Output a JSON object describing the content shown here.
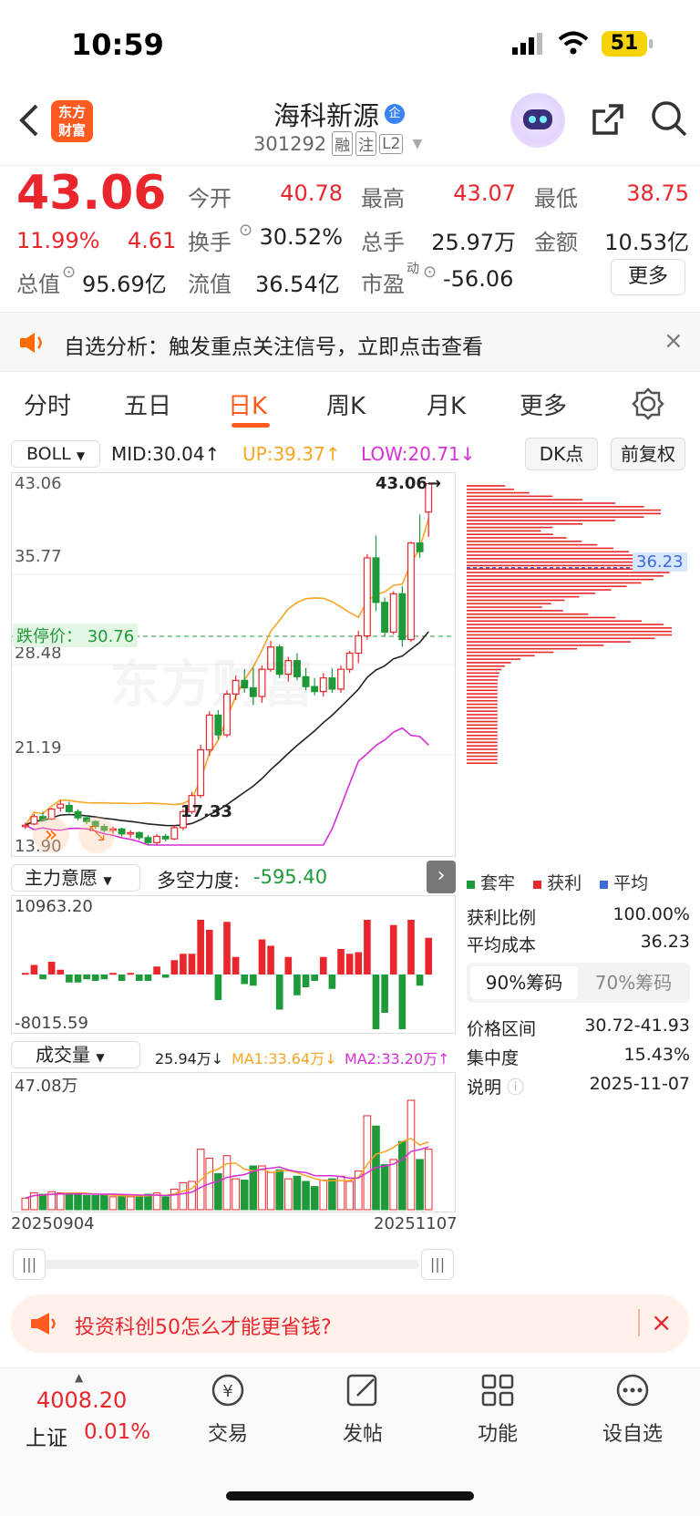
{
  "status": {
    "time": "10:59",
    "battery": "51"
  },
  "header": {
    "logo_line1": "东方",
    "logo_line2": "财富",
    "stock_name": "海科新源",
    "badge": "企",
    "code": "301292",
    "tags": [
      "融",
      "注",
      "L2"
    ]
  },
  "quote": {
    "price": "43.06",
    "pct": "11.99%",
    "change": "4.61",
    "open_label": "今开",
    "open": "40.78",
    "high_label": "最高",
    "high": "43.07",
    "low_label": "最低",
    "low": "38.75",
    "turnover_label": "换手",
    "turnover": "30.52%",
    "volume_label": "总手",
    "volume": "25.97万",
    "amount_label": "金额",
    "amount": "10.53亿",
    "mktcap_label": "总值",
    "mktcap": "95.69亿",
    "float_label": "流值",
    "float_cap": "36.54亿",
    "pe_label": "市盈",
    "pe_sup": "动",
    "pe": "-56.06",
    "more": "更多"
  },
  "notice": {
    "text": "自选分析：触发重点关注信号，立即点击查看"
  },
  "tabs": [
    "分时",
    "五日",
    "日K",
    "周K",
    "月K",
    "更多"
  ],
  "indicator": {
    "name": "BOLL",
    "mid": "MID:30.04↑",
    "up": "UP:39.37↑",
    "low": "LOW:20.71↓",
    "dk": "DK点",
    "fq": "前复权"
  },
  "kchart": {
    "y_labels": [
      "43.06",
      "35.77",
      "28.48",
      "21.19",
      "13.90"
    ],
    "limit_down": "跌停价： 30.76",
    "max_label": "43.06→",
    "min_label": "17.33",
    "watermark": "东方财富",
    "cost_avg": "36.23"
  },
  "flow": {
    "name": "主力意愿",
    "label": "多空力度:",
    "value": "-595.40",
    "max": "10963.20",
    "min": "-8015.59"
  },
  "vol": {
    "name": "成交量",
    "cur": "25.94万↓",
    "ma1": "MA1:33.64万↓",
    "ma2": "MA2:33.20万↑",
    "max": "47.08万",
    "date_start": "20250904",
    "date_end": "20251107"
  },
  "chips": {
    "legend": [
      "套牢",
      "获利",
      "平均"
    ],
    "profit_label": "获利比例",
    "profit": "100.00%",
    "avg_label": "平均成本",
    "avg": "36.23",
    "tab90": "90%筹码",
    "tab70": "70%筹码",
    "range_label": "价格区间",
    "range": "30.72-41.93",
    "conc_label": "集中度",
    "conc": "15.43%",
    "note_label": "说明",
    "date": "2025-11-07"
  },
  "ad": {
    "text": "投资科创50怎么才能更省钱?"
  },
  "bottom": {
    "index_value": "4008.20",
    "index_name": "上证",
    "index_pct": "0.01%",
    "items": [
      "交易",
      "发帖",
      "功能",
      "设自选"
    ]
  },
  "colors": {
    "up": "#e8262c",
    "down": "#1f9a3a",
    "boll_up": "#f5a623",
    "boll_low": "#d62fd6",
    "accent": "#ff6a00"
  },
  "chart_data": {
    "type": "candlestick",
    "candles": [
      [
        15.4,
        15.7,
        15.2,
        15.5
      ],
      [
        15.6,
        16.4,
        15.5,
        16.2
      ],
      [
        16.2,
        16.6,
        15.8,
        15.9
      ],
      [
        16.0,
        16.9,
        15.9,
        16.8
      ],
      [
        16.9,
        17.5,
        16.6,
        17.2
      ],
      [
        17.1,
        17.4,
        16.5,
        16.6
      ],
      [
        16.6,
        16.8,
        15.9,
        16.1
      ],
      [
        16.1,
        16.3,
        15.6,
        15.8
      ],
      [
        15.8,
        15.9,
        15.2,
        15.4
      ],
      [
        15.4,
        15.6,
        14.9,
        15.1
      ],
      [
        15.1,
        15.4,
        14.8,
        15.2
      ],
      [
        15.2,
        15.3,
        14.6,
        14.8
      ],
      [
        14.8,
        15.1,
        14.5,
        14.9
      ],
      [
        14.9,
        15.0,
        14.3,
        14.5
      ],
      [
        14.5,
        14.7,
        13.9,
        14.1
      ],
      [
        14.1,
        14.8,
        13.9,
        14.6
      ],
      [
        14.6,
        14.8,
        14.2,
        14.4
      ],
      [
        14.4,
        15.5,
        14.3,
        15.3
      ],
      [
        15.3,
        16.8,
        15.1,
        16.6
      ],
      [
        16.6,
        18.2,
        16.4,
        17.9
      ],
      [
        17.9,
        22.0,
        17.7,
        21.6
      ],
      [
        21.6,
        24.7,
        21.1,
        24.4
      ],
      [
        24.4,
        24.8,
        22.4,
        22.8
      ],
      [
        22.8,
        26.4,
        22.6,
        26.1
      ],
      [
        26.1,
        27.6,
        25.6,
        27.2
      ],
      [
        27.2,
        28.1,
        26.2,
        26.6
      ],
      [
        26.6,
        28.2,
        25.2,
        25.9
      ],
      [
        25.9,
        28.4,
        25.4,
        28.1
      ],
      [
        28.1,
        30.4,
        27.9,
        29.9
      ],
      [
        29.9,
        30.1,
        27.4,
        27.7
      ],
      [
        27.7,
        29.1,
        27.1,
        28.8
      ],
      [
        28.8,
        29.4,
        27.2,
        27.5
      ],
      [
        27.5,
        28.2,
        26.4,
        26.7
      ],
      [
        26.7,
        27.4,
        26.0,
        26.3
      ],
      [
        26.3,
        27.8,
        25.9,
        27.4
      ],
      [
        27.4,
        28.2,
        26.2,
        26.5
      ],
      [
        26.5,
        28.4,
        26.2,
        28.1
      ],
      [
        28.1,
        29.6,
        27.8,
        29.4
      ],
      [
        29.4,
        31.2,
        28.6,
        30.8
      ],
      [
        30.8,
        37.4,
        30.5,
        37.1
      ],
      [
        37.1,
        38.9,
        32.8,
        33.5
      ],
      [
        33.5,
        33.9,
        30.8,
        31.1
      ],
      [
        31.1,
        34.4,
        30.9,
        34.2
      ],
      [
        34.2,
        34.8,
        29.9,
        30.5
      ],
      [
        30.5,
        38.4,
        30.3,
        38.3
      ],
      [
        38.3,
        40.6,
        37.1,
        37.6
      ],
      [
        40.8,
        43.1,
        38.8,
        43.1
      ]
    ]
  }
}
